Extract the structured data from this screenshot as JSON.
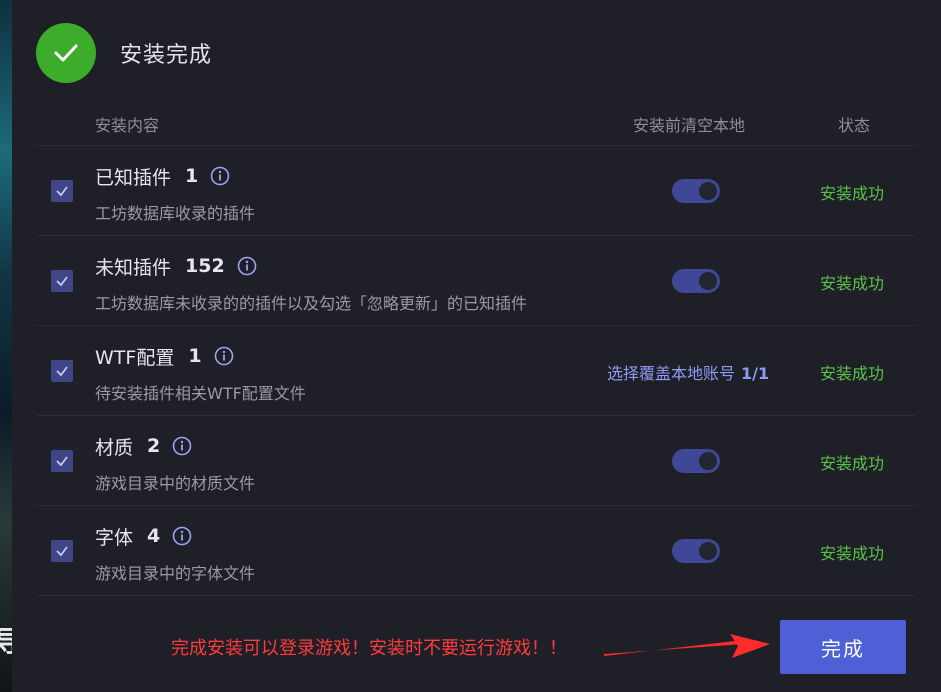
{
  "dialog": {
    "title": "安装完成"
  },
  "columns": {
    "content": "安装内容",
    "clear_local": "安装前清空本地",
    "status": "状态"
  },
  "rows": [
    {
      "title": "已知插件",
      "count": "1",
      "description": "工坊数据库收录的插件",
      "checked": true,
      "clear_local": "toggle-on",
      "status": "安装成功"
    },
    {
      "title": "未知插件",
      "count": "152",
      "description": "工坊数据库未收录的的插件以及勾选「忽略更新」的已知插件",
      "checked": true,
      "clear_local": "toggle-on",
      "status": "安装成功"
    },
    {
      "title": "WTF配置",
      "count": "1",
      "description": "待安装插件相关WTF配置文件",
      "checked": true,
      "choose_label": "选择覆盖本地账号",
      "choose_fraction": "1/1",
      "status": "安装成功"
    },
    {
      "title": "材质",
      "count": "2",
      "description": "游戏目录中的材质文件",
      "checked": true,
      "clear_local": "toggle-on",
      "status": "安装成功"
    },
    {
      "title": "字体",
      "count": "4",
      "description": "游戏目录中的字体文件",
      "checked": true,
      "clear_local": "toggle-on",
      "status": "安装成功"
    }
  ],
  "footer": {
    "warning": "完成安装可以登录游戏！安装时不要运行游戏！！",
    "done_label": "完成"
  },
  "colors": {
    "success": "#5bc34a",
    "accent": "#4d60d6",
    "warning": "#ff3b3b",
    "check_circle": "#3cac2a"
  },
  "background_partial_text": "导"
}
